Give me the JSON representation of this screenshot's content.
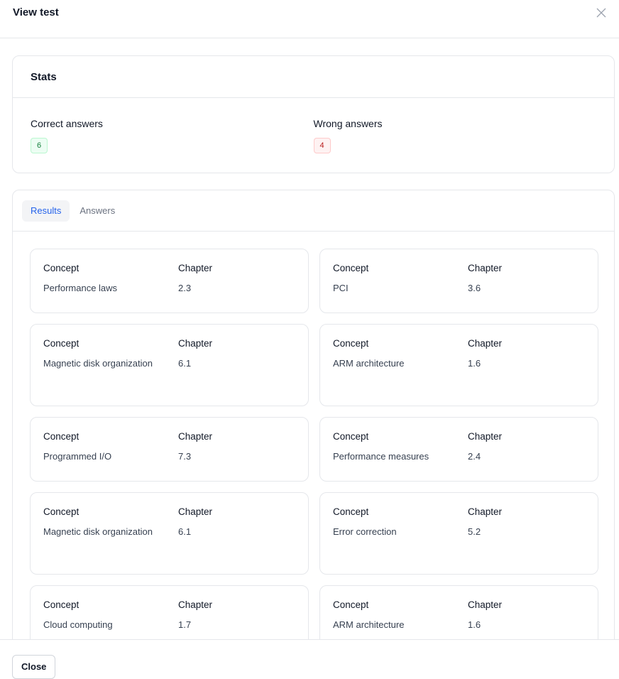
{
  "modal": {
    "title": "View test",
    "close_label": "Close"
  },
  "stats": {
    "heading": "Stats",
    "correct_label": "Correct answers",
    "correct_value": "6",
    "wrong_label": "Wrong answers",
    "wrong_value": "4"
  },
  "tabs": [
    {
      "label": "Results",
      "active": true
    },
    {
      "label": "Answers",
      "active": false
    }
  ],
  "results": {
    "concept_header": "Concept",
    "chapter_header": "Chapter",
    "items": [
      {
        "concept": "Performance laws",
        "chapter": "2.3"
      },
      {
        "concept": "PCI",
        "chapter": "3.6"
      },
      {
        "concept": "Magnetic disk organization",
        "chapter": "6.1"
      },
      {
        "concept": "ARM architecture",
        "chapter": "1.6"
      },
      {
        "concept": "Programmed I/O",
        "chapter": "7.3"
      },
      {
        "concept": "Performance measures",
        "chapter": "2.4"
      },
      {
        "concept": "Magnetic disk organization",
        "chapter": "6.1"
      },
      {
        "concept": "Error correction",
        "chapter": "5.2"
      },
      {
        "concept": "Cloud computing",
        "chapter": "1.7"
      },
      {
        "concept": "ARM architecture",
        "chapter": "1.6"
      }
    ]
  },
  "colors": {
    "accent": "#2563eb",
    "correct": "#15803d",
    "wrong": "#b91c1c",
    "border": "#e5e7eb"
  },
  "icons": {
    "close": "close-icon"
  }
}
